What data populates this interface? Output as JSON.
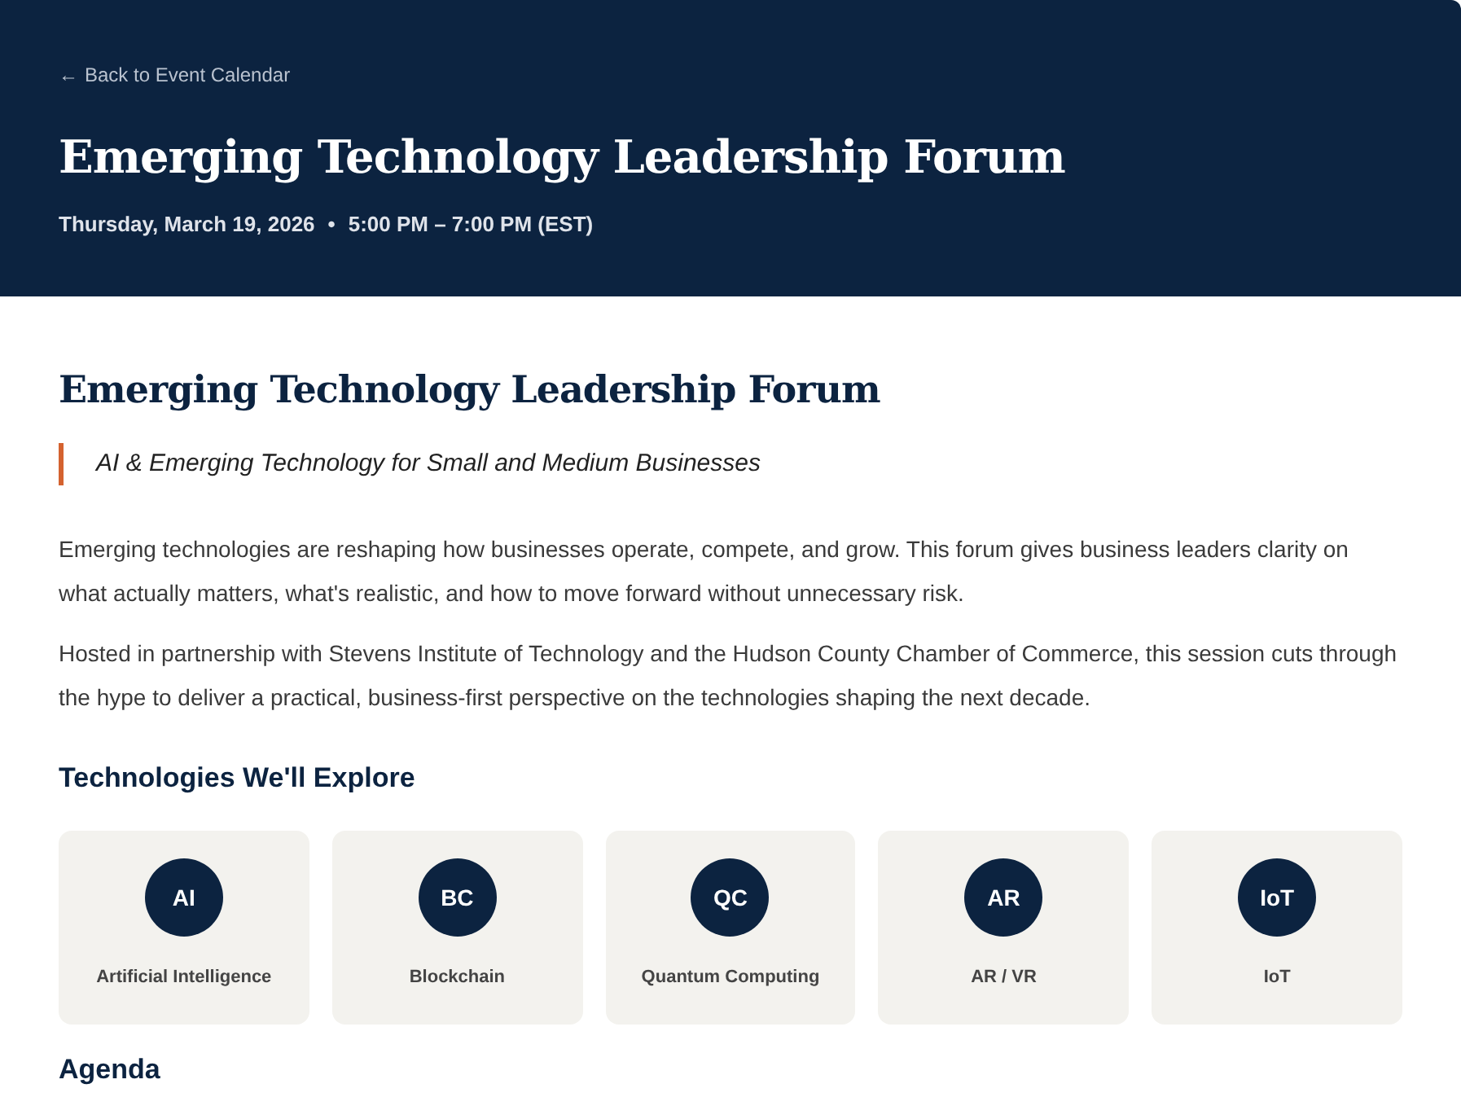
{
  "header": {
    "back_link": {
      "arrow": "←",
      "label": "Back to Event Calendar"
    },
    "title": "Emerging Technology Leadership Forum",
    "date": "Thursday, March 19, 2026",
    "separator": "•",
    "time": "5:00 PM – 7:00 PM (EST)"
  },
  "main": {
    "title": "Emerging Technology Leadership Forum",
    "tagline": "AI & Emerging Technology for Small and Medium Businesses",
    "paragraphs": [
      "Emerging technologies are reshaping how businesses operate, compete, and grow. This forum gives business leaders clarity on what actually matters, what's realistic, and how to move forward without unnecessary risk.",
      "Hosted in partnership with Stevens Institute of Technology and the Hudson County Chamber of Commerce, this session cuts through the hype to deliver a practical, business-first perspective on the technologies shaping the next decade."
    ],
    "technologies_heading": "Technologies We'll Explore",
    "technologies": [
      {
        "abbr": "AI",
        "name": "Artificial Intelligence"
      },
      {
        "abbr": "BC",
        "name": "Blockchain"
      },
      {
        "abbr": "QC",
        "name": "Quantum Computing"
      },
      {
        "abbr": "AR",
        "name": "AR / VR"
      },
      {
        "abbr": "IoT",
        "name": "IoT"
      }
    ],
    "next_heading": "Agenda"
  }
}
